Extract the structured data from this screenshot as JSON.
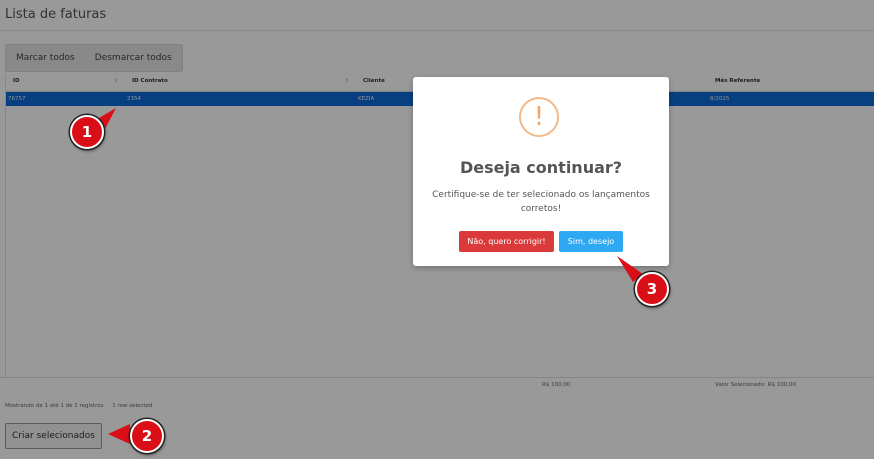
{
  "page": {
    "title": "Lista de faturas"
  },
  "toolbar": {
    "mark_all": "Marcar todos",
    "unmark_all": "Desmarcar todos"
  },
  "table": {
    "columns": [
      "ID",
      "ID Contrato",
      "Cliente",
      "Mês Referente"
    ],
    "rows": [
      {
        "id": "76757",
        "contract_id": "2354",
        "client": "KEZIA",
        "month_ref": "8/2025"
      }
    ],
    "footer": {
      "total": "R$ 100,00",
      "selected_value": "Valor Selecionado: R$ 100,00"
    },
    "info": "Mostrando de 1 até 1 de 1 registros",
    "selected_info": "1 row selected"
  },
  "actions": {
    "create_selected": "Criar selecionados"
  },
  "modal": {
    "icon": "!",
    "title": "Deseja continuar?",
    "text": "Certifique-se de ter selecionado os lançamentos corretos!",
    "cancel_label": "Não, quero corrigir!",
    "confirm_label": "Sim, desejo"
  },
  "annotations": {
    "step1": "1",
    "step2": "2",
    "step3": "3"
  },
  "colors": {
    "selected_row": "#0d6ad6",
    "cancel_button": "#dc3a3a",
    "confirm_button": "#2ea8f2",
    "badge": "#d90e17",
    "warning_icon": "#f0a869"
  }
}
